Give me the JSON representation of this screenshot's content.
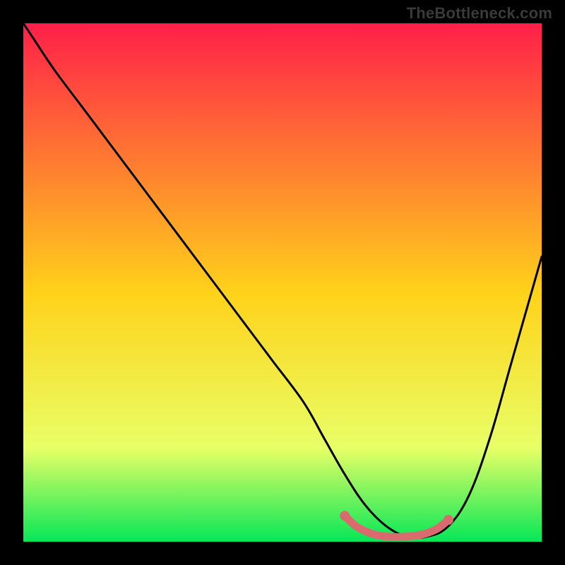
{
  "watermark": "TheBottleneck.com",
  "colors": {
    "page_bg": "#000000",
    "gradient_top": "#ff1f49",
    "gradient_mid": "#ffd21a",
    "gradient_low": "#e8ff66",
    "gradient_bottom": "#06e756",
    "curve": "#000000",
    "highlight": "#d96b6e"
  },
  "chart_data": {
    "type": "line",
    "title": "",
    "xlabel": "",
    "ylabel": "",
    "xlim": [
      0,
      100
    ],
    "ylim": [
      0,
      100
    ],
    "series": [
      {
        "name": "curve",
        "x": [
          0,
          2,
          6,
          12,
          18,
          24,
          30,
          36,
          42,
          48,
          54,
          58,
          62,
          66,
          70,
          74,
          78,
          82,
          86,
          90,
          94,
          98,
          100
        ],
        "y": [
          100,
          97,
          91,
          83,
          75,
          67,
          59,
          51,
          43,
          35,
          27,
          20,
          13,
          7,
          3,
          1,
          1,
          3,
          9,
          20,
          34,
          48,
          55
        ]
      },
      {
        "name": "highlight",
        "x": [
          62,
          64,
          66,
          68,
          70,
          72,
          74,
          76,
          78,
          80,
          82
        ],
        "y": [
          5.0,
          3.1,
          2.0,
          1.3,
          1.0,
          0.9,
          1.0,
          1.2,
          1.7,
          2.6,
          4.2
        ]
      }
    ]
  }
}
